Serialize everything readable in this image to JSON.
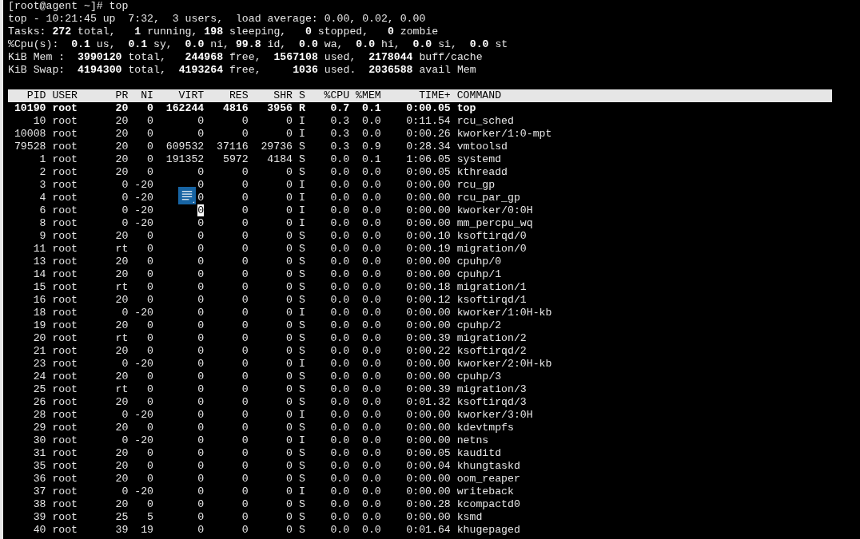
{
  "prompt": "[root@agent ~]# top",
  "summary": [
    "top - 10:21:45 up  7:32,  3 users,  load average: 0.00, 0.02, 0.00",
    "Tasks: **272** total,   **1** running, **198** sleeping,   **0** stopped,   **0** zombie",
    "%Cpu(s):  **0.1** us,  **0.1** sy,  **0.0** ni, **99.8** id,  **0.0** wa,  **0.0** hi,  **0.0** si,  **0.0** st",
    "KiB Mem :  **3990120** total,   **244968** free,  **1567108** used,  **2178044** buff/cache",
    "KiB Swap:  **4194300** total,  **4193264** free,     **1036** used.  **2036588** avail Mem"
  ],
  "table": {
    "columns": [
      "PID",
      "USER",
      "PR",
      "NI",
      "VIRT",
      "RES",
      "SHR",
      "S",
      "%CPU",
      "%MEM",
      "TIME+",
      "COMMAND"
    ],
    "rows": [
      {
        "cells": [
          "10190",
          "root",
          "20",
          "0",
          "162244",
          "4816",
          "3956",
          "R",
          "0.7",
          "0.1",
          "0:00.05",
          "top"
        ],
        "highlighted": true,
        "cursor": false
      },
      {
        "cells": [
          "10",
          "root",
          "20",
          "0",
          "0",
          "0",
          "0",
          "I",
          "0.3",
          "0.0",
          "0:11.54",
          "rcu_sched"
        ],
        "highlighted": false,
        "cursor": false
      },
      {
        "cells": [
          "10008",
          "root",
          "20",
          "0",
          "0",
          "0",
          "0",
          "I",
          "0.3",
          "0.0",
          "0:00.26",
          "kworker/1:0-mpt"
        ],
        "highlighted": false,
        "cursor": false
      },
      {
        "cells": [
          "79528",
          "root",
          "20",
          "0",
          "609532",
          "37116",
          "29736",
          "S",
          "0.3",
          "0.9",
          "0:28.34",
          "vmtoolsd"
        ],
        "highlighted": false,
        "cursor": false
      },
      {
        "cells": [
          "1",
          "root",
          "20",
          "0",
          "191352",
          "5972",
          "4184",
          "S",
          "0.0",
          "0.1",
          "1:06.05",
          "systemd"
        ],
        "highlighted": false,
        "cursor": false
      },
      {
        "cells": [
          "2",
          "root",
          "20",
          "0",
          "0",
          "0",
          "0",
          "S",
          "0.0",
          "0.0",
          "0:00.05",
          "kthreadd"
        ],
        "highlighted": false,
        "cursor": false
      },
      {
        "cells": [
          "3",
          "root",
          "0",
          "-20",
          "0",
          "0",
          "0",
          "I",
          "0.0",
          "0.0",
          "0:00.00",
          "rcu_gp"
        ],
        "highlighted": false,
        "cursor": false
      },
      {
        "cells": [
          "4",
          "root",
          "0",
          "-20",
          "0",
          "0",
          "0",
          "I",
          "0.0",
          "0.0",
          "0:00.00",
          "rcu_par_gp"
        ],
        "highlighted": false,
        "cursor": false
      },
      {
        "cells": [
          "6",
          "root",
          "0",
          "-20",
          "0",
          "0",
          "0",
          "I",
          "0.0",
          "0.0",
          "0:00.00",
          "kworker/0:0H"
        ],
        "highlighted": false,
        "cursor": true
      },
      {
        "cells": [
          "8",
          "root",
          "0",
          "-20",
          "0",
          "0",
          "0",
          "I",
          "0.0",
          "0.0",
          "0:00.00",
          "mm_percpu_wq"
        ],
        "highlighted": false,
        "cursor": false
      },
      {
        "cells": [
          "9",
          "root",
          "20",
          "0",
          "0",
          "0",
          "0",
          "S",
          "0.0",
          "0.0",
          "0:00.10",
          "ksoftirqd/0"
        ],
        "highlighted": false,
        "cursor": false
      },
      {
        "cells": [
          "11",
          "root",
          "rt",
          "0",
          "0",
          "0",
          "0",
          "S",
          "0.0",
          "0.0",
          "0:00.19",
          "migration/0"
        ],
        "highlighted": false,
        "cursor": false
      },
      {
        "cells": [
          "13",
          "root",
          "20",
          "0",
          "0",
          "0",
          "0",
          "S",
          "0.0",
          "0.0",
          "0:00.00",
          "cpuhp/0"
        ],
        "highlighted": false,
        "cursor": false
      },
      {
        "cells": [
          "14",
          "root",
          "20",
          "0",
          "0",
          "0",
          "0",
          "S",
          "0.0",
          "0.0",
          "0:00.00",
          "cpuhp/1"
        ],
        "highlighted": false,
        "cursor": false
      },
      {
        "cells": [
          "15",
          "root",
          "rt",
          "0",
          "0",
          "0",
          "0",
          "S",
          "0.0",
          "0.0",
          "0:00.18",
          "migration/1"
        ],
        "highlighted": false,
        "cursor": false
      },
      {
        "cells": [
          "16",
          "root",
          "20",
          "0",
          "0",
          "0",
          "0",
          "S",
          "0.0",
          "0.0",
          "0:00.12",
          "ksoftirqd/1"
        ],
        "highlighted": false,
        "cursor": false
      },
      {
        "cells": [
          "18",
          "root",
          "0",
          "-20",
          "0",
          "0",
          "0",
          "I",
          "0.0",
          "0.0",
          "0:00.00",
          "kworker/1:0H-kb"
        ],
        "highlighted": false,
        "cursor": false
      },
      {
        "cells": [
          "19",
          "root",
          "20",
          "0",
          "0",
          "0",
          "0",
          "S",
          "0.0",
          "0.0",
          "0:00.00",
          "cpuhp/2"
        ],
        "highlighted": false,
        "cursor": false
      },
      {
        "cells": [
          "20",
          "root",
          "rt",
          "0",
          "0",
          "0",
          "0",
          "S",
          "0.0",
          "0.0",
          "0:00.39",
          "migration/2"
        ],
        "highlighted": false,
        "cursor": false
      },
      {
        "cells": [
          "21",
          "root",
          "20",
          "0",
          "0",
          "0",
          "0",
          "S",
          "0.0",
          "0.0",
          "0:00.22",
          "ksoftirqd/2"
        ],
        "highlighted": false,
        "cursor": false
      },
      {
        "cells": [
          "23",
          "root",
          "0",
          "-20",
          "0",
          "0",
          "0",
          "I",
          "0.0",
          "0.0",
          "0:00.00",
          "kworker/2:0H-kb"
        ],
        "highlighted": false,
        "cursor": false
      },
      {
        "cells": [
          "24",
          "root",
          "20",
          "0",
          "0",
          "0",
          "0",
          "S",
          "0.0",
          "0.0",
          "0:00.00",
          "cpuhp/3"
        ],
        "highlighted": false,
        "cursor": false
      },
      {
        "cells": [
          "25",
          "root",
          "rt",
          "0",
          "0",
          "0",
          "0",
          "S",
          "0.0",
          "0.0",
          "0:00.39",
          "migration/3"
        ],
        "highlighted": false,
        "cursor": false
      },
      {
        "cells": [
          "26",
          "root",
          "20",
          "0",
          "0",
          "0",
          "0",
          "S",
          "0.0",
          "0.0",
          "0:01.32",
          "ksoftirqd/3"
        ],
        "highlighted": false,
        "cursor": false
      },
      {
        "cells": [
          "28",
          "root",
          "0",
          "-20",
          "0",
          "0",
          "0",
          "I",
          "0.0",
          "0.0",
          "0:00.00",
          "kworker/3:0H"
        ],
        "highlighted": false,
        "cursor": false
      },
      {
        "cells": [
          "29",
          "root",
          "20",
          "0",
          "0",
          "0",
          "0",
          "S",
          "0.0",
          "0.0",
          "0:00.00",
          "kdevtmpfs"
        ],
        "highlighted": false,
        "cursor": false
      },
      {
        "cells": [
          "30",
          "root",
          "0",
          "-20",
          "0",
          "0",
          "0",
          "I",
          "0.0",
          "0.0",
          "0:00.00",
          "netns"
        ],
        "highlighted": false,
        "cursor": false
      },
      {
        "cells": [
          "31",
          "root",
          "20",
          "0",
          "0",
          "0",
          "0",
          "S",
          "0.0",
          "0.0",
          "0:00.05",
          "kauditd"
        ],
        "highlighted": false,
        "cursor": false
      },
      {
        "cells": [
          "35",
          "root",
          "20",
          "0",
          "0",
          "0",
          "0",
          "S",
          "0.0",
          "0.0",
          "0:00.04",
          "khungtaskd"
        ],
        "highlighted": false,
        "cursor": false
      },
      {
        "cells": [
          "36",
          "root",
          "20",
          "0",
          "0",
          "0",
          "0",
          "S",
          "0.0",
          "0.0",
          "0:00.00",
          "oom_reaper"
        ],
        "highlighted": false,
        "cursor": false
      },
      {
        "cells": [
          "37",
          "root",
          "0",
          "-20",
          "0",
          "0",
          "0",
          "I",
          "0.0",
          "0.0",
          "0:00.00",
          "writeback"
        ],
        "highlighted": false,
        "cursor": false
      },
      {
        "cells": [
          "38",
          "root",
          "20",
          "0",
          "0",
          "0",
          "0",
          "S",
          "0.0",
          "0.0",
          "0:00.28",
          "kcompactd0"
        ],
        "highlighted": false,
        "cursor": false
      },
      {
        "cells": [
          "39",
          "root",
          "25",
          "5",
          "0",
          "0",
          "0",
          "S",
          "0.0",
          "0.0",
          "0:00.00",
          "ksmd"
        ],
        "highlighted": false,
        "cursor": false
      },
      {
        "cells": [
          "40",
          "root",
          "39",
          "19",
          "0",
          "0",
          "0",
          "S",
          "0.0",
          "0.0",
          "0:01.64",
          "khugepaged"
        ],
        "highlighted": false,
        "cursor": false
      }
    ]
  }
}
